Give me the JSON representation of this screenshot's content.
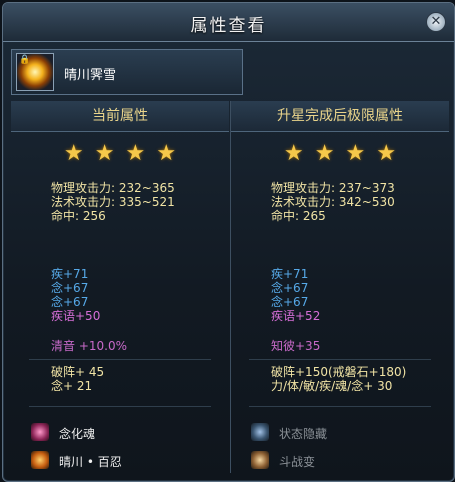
{
  "window": {
    "title": "属性查看",
    "close_label": "✕"
  },
  "item": {
    "name": "晴川霁雪",
    "icon": "sun-orb-icon"
  },
  "left": {
    "header": "当前属性",
    "stars": 4,
    "base": [
      "物理攻击力: 232~365",
      "法术攻击力: 335~521",
      "命中: 256"
    ],
    "bonus": [
      "疾+71",
      "念+67",
      "念+67",
      "疾语+50"
    ],
    "special": "清音 +10.0%",
    "extra": [
      "破阵+ 45",
      "念+ 21"
    ],
    "skills": [
      "念化魂",
      "晴川 • 百忍"
    ]
  },
  "right": {
    "header": "升星完成后极限属性",
    "stars": 4,
    "base": [
      "物理攻击力: 237~373",
      "法术攻击力: 342~530",
      "命中: 265"
    ],
    "bonus": [
      "疾+71",
      "念+67",
      "念+67",
      "疾语+52"
    ],
    "special": "知彼+35",
    "extra": [
      "破阵+150(戒磐石+180)",
      "力/体/敏/疾/魂/念+ 30"
    ],
    "skills": [
      "状态隐藏",
      "斗战变"
    ]
  },
  "star_glyph": "★"
}
